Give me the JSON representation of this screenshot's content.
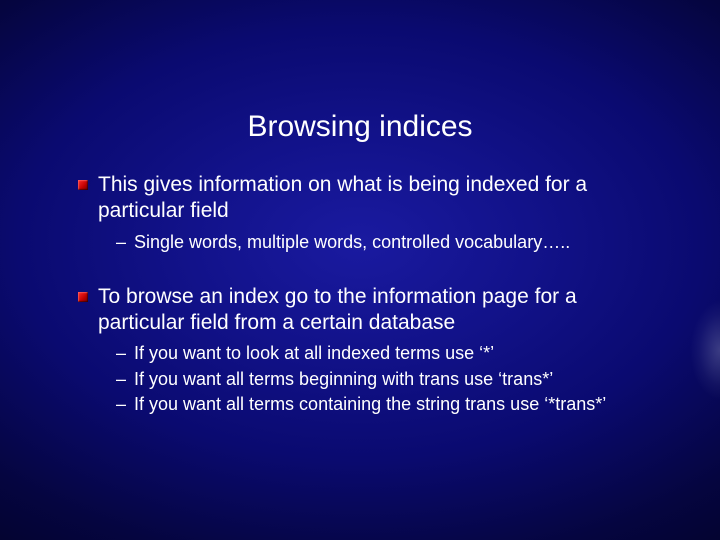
{
  "title": "Browsing indices",
  "bullets": [
    {
      "text": "This gives information on what is being indexed for a particular field",
      "sub": [
        "Single words, multiple words, controlled vocabulary….."
      ]
    },
    {
      "text": "To browse an index go to the information page for a particular field from a certain database",
      "sub": [
        "If you want to look at all indexed terms use ‘*’",
        "If you want all terms beginning with trans use ‘trans*’",
        "If you want all terms containing the string trans use ‘*trans*’"
      ]
    }
  ]
}
